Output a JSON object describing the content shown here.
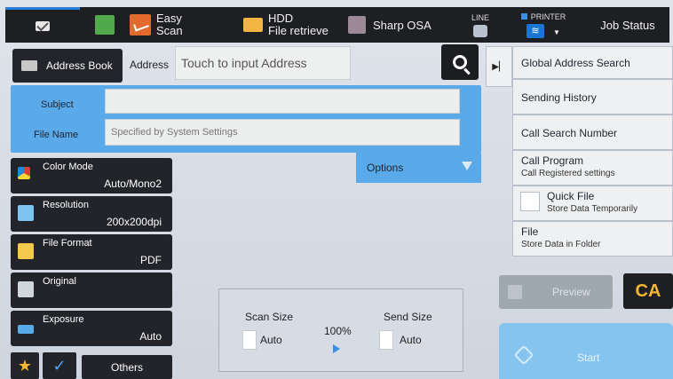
{
  "topbar": {
    "easy_scan": [
      "Easy",
      "Scan"
    ],
    "hdd": [
      "HDD",
      "File retrieve"
    ],
    "sharp_osa": "Sharp OSA",
    "line": "LINE",
    "printer": "PRINTER",
    "job_status": "Job Status"
  },
  "address": {
    "book_label": "Address Book",
    "label": "Address",
    "placeholder": "Touch to input Address"
  },
  "form": {
    "subject_label": "Subject",
    "subject_value": "",
    "file_name_label": "File Name",
    "file_name_placeholder": "Specified by System Settings",
    "options_label": "Options"
  },
  "settings": [
    {
      "label": "Color Mode",
      "value": "Auto/Mono2",
      "icon": "color-mode-icon"
    },
    {
      "label": "Resolution",
      "value": "200x200dpi",
      "icon": "resolution-icon"
    },
    {
      "label": "File Format",
      "value": "PDF",
      "icon": "file-format-icon"
    },
    {
      "label": "Original",
      "value": "",
      "icon": "original-icon"
    },
    {
      "label": "Exposure",
      "value": "Auto",
      "icon": "exposure-icon"
    }
  ],
  "bottom": {
    "others": "Others"
  },
  "scan_size": {
    "scan_label": "Scan Size",
    "scan_value": "Auto",
    "ratio": "100%",
    "send_label": "Send Size",
    "send_value": "Auto"
  },
  "right_panel": {
    "global_search": "Global Address Search",
    "sending_history": "Sending History",
    "call_search_number": "Call Search Number",
    "call_program": "Call Program",
    "call_program_sub": "Call Registered settings",
    "quick_file": "Quick File",
    "quick_file_sub": "Store Data Temporarily",
    "file": "File",
    "file_sub": "Store Data in Folder"
  },
  "actions": {
    "preview": "Preview",
    "ca": "CA",
    "start": "Start"
  },
  "colors": {
    "accent_blue": "#5aa9e8",
    "dark_button": "#22242a",
    "ca_yellow": "#f2b631",
    "start_blue": "#84c4ef"
  }
}
